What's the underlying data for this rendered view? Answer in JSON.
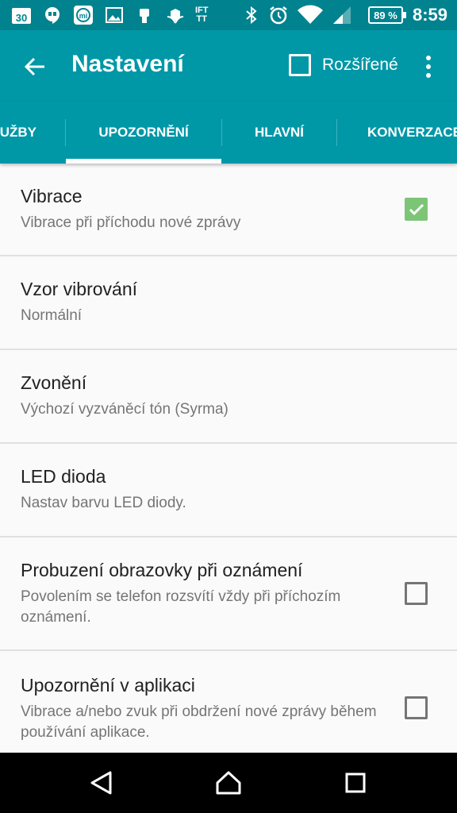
{
  "status_bar": {
    "time": "8:59",
    "battery": "89 %",
    "icons": [
      "calendar-icon",
      "hangouts-icon",
      "mi-icon",
      "image-icon",
      "broom-icon",
      "tulip-icon",
      "ifttt-icon",
      "bluetooth-icon",
      "alarm-icon",
      "wifi-icon",
      "signal-icon",
      "battery-icon"
    ],
    "calendar_day": "30",
    "ifttt_label": "IFT\nTT"
  },
  "app_bar": {
    "title": "Nastavení",
    "advanced_label": "Rozšířené",
    "advanced_checked": false
  },
  "tabs": [
    {
      "label": "UŽBY",
      "active": false
    },
    {
      "label": "UPOZORNĚNÍ",
      "active": true
    },
    {
      "label": "HLAVNÍ",
      "active": false
    },
    {
      "label": "KONVERZACE",
      "active": false
    }
  ],
  "settings": [
    {
      "title": "Vibrace",
      "subtitle": "Vibrace při příchodu nové zprávy",
      "checkbox": "checked"
    },
    {
      "title": "Vzor vibrování",
      "subtitle": "Normální",
      "checkbox": "none"
    },
    {
      "title": "Zvonění",
      "subtitle": "Výchozí vyzváněcí tón (Syrma)",
      "checkbox": "none"
    },
    {
      "title": "LED dioda",
      "subtitle": "Nastav barvu LED diody.",
      "checkbox": "none"
    },
    {
      "title": "Probuzení obrazovky při oznámení",
      "subtitle": "Povolením se telefon rozsvítí vždy při příchozím oznámení.",
      "checkbox": "unchecked"
    },
    {
      "title": "Upozornění v aplikaci",
      "subtitle": "Vibrace a/nebo zvuk při obdržení nové zprávy během používání aplikace.",
      "checkbox": "unchecked"
    }
  ],
  "nav_bar": {
    "buttons": [
      "back-triangle-icon",
      "home-icon",
      "recents-icon"
    ]
  },
  "colors": {
    "status_bar": "#00838f",
    "app_bar": "#0097a7",
    "checkbox_checked": "#7cc576"
  }
}
